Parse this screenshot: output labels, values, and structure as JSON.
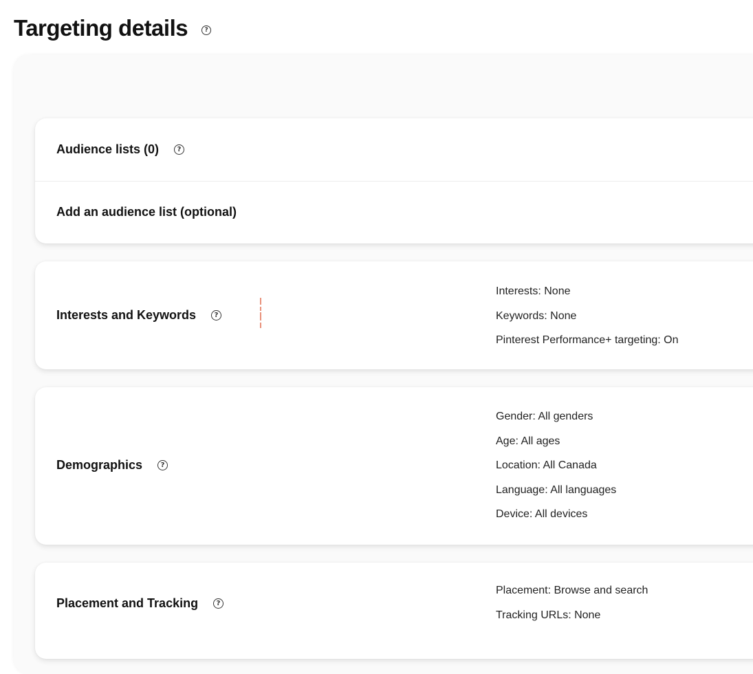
{
  "page": {
    "title": "Targeting details",
    "help_icon": "help-circle-icon"
  },
  "audience": {
    "title": "Audience lists (0)",
    "add_label": "Add an audience list (optional)"
  },
  "interests": {
    "title": "Interests and Keywords",
    "summary": [
      "Interests: None",
      "Keywords: None",
      "Pinterest Performance+ targeting: On"
    ]
  },
  "demographics": {
    "title": "Demographics",
    "summary": [
      "Gender: All genders",
      "Age: All ages",
      "Location: All Canada",
      "Language: All languages",
      "Device: All devices"
    ]
  },
  "placement": {
    "title": "Placement and Tracking",
    "summary": [
      "Placement: Browse and search",
      "Tracking URLs: None"
    ]
  },
  "colors": {
    "text": "#111111",
    "card_bg": "#ffffff",
    "outer_bg": "#fafafa",
    "cursor_mark": "#e8907a"
  }
}
